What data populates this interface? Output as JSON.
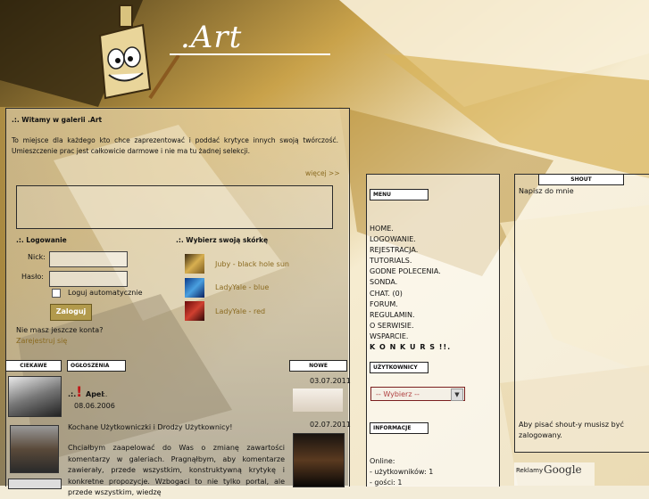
{
  "logo": {
    "text": ".Art"
  },
  "welcome": {
    "title": ".:. Witamy w galerii .Art",
    "body": "To miejsce dla każdego kto chce zaprezentować i poddać krytyce innych swoją twórczość. Umieszczenie prac jest całkowicie darmowe i nie ma tu żadnej selekcji.",
    "more_link": "więcej >>"
  },
  "login": {
    "title": ".:. Logowanie",
    "nick_label": "Nick:",
    "password_label": "Hasło:",
    "remember_label": "Loguj automatycznie",
    "submit_label": "Zaloguj",
    "no_account": "Nie masz jeszcze konta?",
    "register_link": "Zarejestruj się"
  },
  "skins": {
    "title": ".:. Wybierz swoją skórkę",
    "items": [
      {
        "label": "Juby - black hole sun"
      },
      {
        "label": "LadyYale - blue"
      },
      {
        "label": "LadyYale - red"
      }
    ]
  },
  "tabs": {
    "ciekawe": "CIEKAWE",
    "ogloszenia": "OGŁOSZENIA",
    "nowe": "NOWE"
  },
  "announcement": {
    "title": "Apel",
    "title_suffix": ":.",
    "date": "08.06.2006",
    "greeting": "Kochane Użytkowniczki i Drodzy Użytkownicy!",
    "body": "Chciałbym zaapelować do Was o zmianę zawartości komentarzy w galeriach. Pragnąłbym, aby komentarze zawierały, przede wszystkim, konstruktywną krytykę i konkretne propozycje. Wzbogaci to nie tylko portal, ale przede wszystkim, wiedzę"
  },
  "new_items": [
    {
      "date": "03.07.2011"
    },
    {
      "date": "02.07.2011"
    }
  ],
  "menu": {
    "title": "MENU",
    "items": [
      "HOME.",
      "LOGOWANIE.",
      "REJESTRACJA.",
      "TUTORIALS.",
      "GODNE POLECENIA.",
      "SONDA.",
      "CHAT. (0)",
      "FORUM.",
      "REGULAMIN.",
      "O SERWISIE.",
      "WSPARCIE.",
      "K O N K U R S !!."
    ]
  },
  "users": {
    "title": "UŻYTKOWNICY",
    "select_value": "-- Wybierz --"
  },
  "info": {
    "title": "INFORMACJE",
    "online_label": "Online:",
    "users_line": "- użytkowników: 1",
    "guests_line": "- gości: 1"
  },
  "shout": {
    "title": "SHOUT",
    "intro": "Napisz do mnie",
    "login_note": "Aby pisać shout-y musisz być zalogowany."
  },
  "ads": {
    "label": "Reklamy",
    "brand": "Google"
  },
  "colors": {
    "link": "#8a6a20",
    "button": "#b29a4c",
    "alert": "#c01818"
  }
}
